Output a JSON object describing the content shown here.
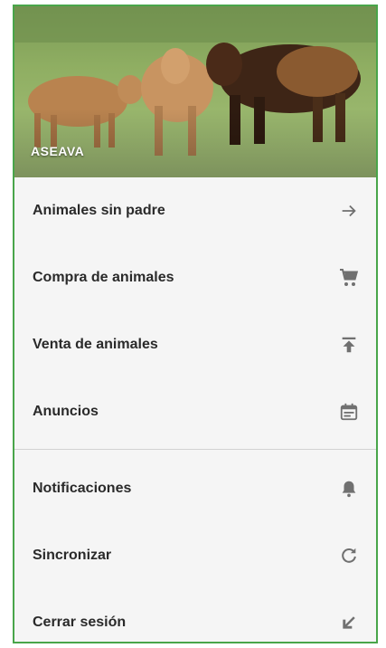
{
  "header": {
    "brand": "ASEAVA"
  },
  "menu": {
    "primary": [
      {
        "label": "Animales sin padre",
        "icon": "arrow-right-icon"
      },
      {
        "label": "Compra de animales",
        "icon": "shopping-cart-icon"
      },
      {
        "label": "Venta de animales",
        "icon": "upload-icon"
      },
      {
        "label": "Anuncios",
        "icon": "calendar-icon"
      }
    ],
    "secondary": [
      {
        "label": "Notificaciones",
        "icon": "bell-icon"
      },
      {
        "label": "Sincronizar",
        "icon": "refresh-icon"
      },
      {
        "label": "Cerrar sesión",
        "icon": "arrow-down-left-icon"
      }
    ]
  },
  "colors": {
    "frame_border": "#49a54a",
    "drawer_background": "#f5f5f5",
    "text": "#2a2a2a",
    "icon": "#707070"
  }
}
